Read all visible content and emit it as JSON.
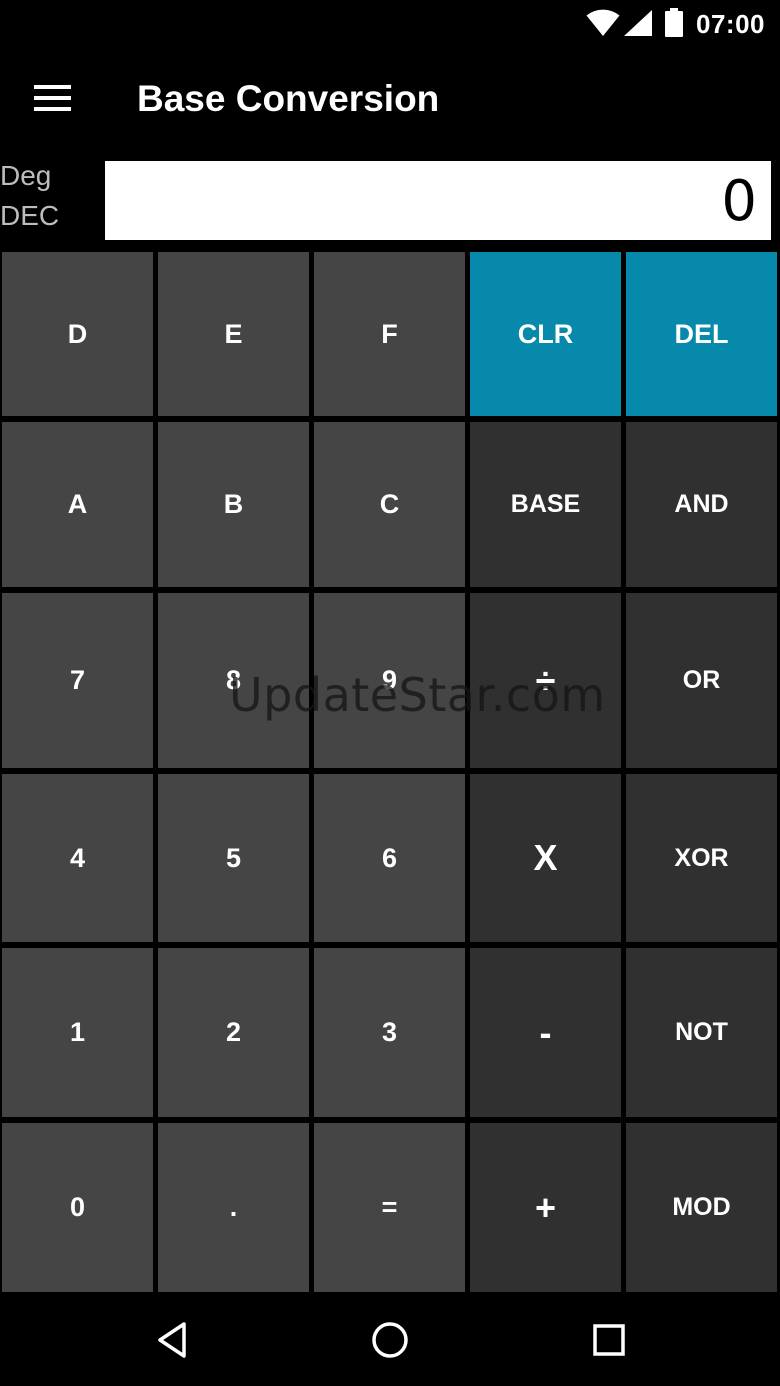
{
  "status_bar": {
    "time": "07:00",
    "icons": [
      "wifi-icon",
      "cell-signal-icon",
      "battery-icon"
    ]
  },
  "app_bar": {
    "title": "Base Conversion",
    "menu_icon": "hamburger-menu-icon"
  },
  "mode": {
    "angle": "Deg",
    "base": "DEC"
  },
  "display": {
    "value": "0"
  },
  "keys": {
    "D": "D",
    "E": "E",
    "F": "F",
    "CLR": "CLR",
    "DEL": "DEL",
    "A": "A",
    "B": "B",
    "C": "C",
    "BASE": "BASE",
    "AND": "AND",
    "n7": "7",
    "n8": "8",
    "n9": "9",
    "div": "÷",
    "OR": "OR",
    "n4": "4",
    "n5": "5",
    "n6": "6",
    "mul": "X",
    "XOR": "XOR",
    "n1": "1",
    "n2": "2",
    "n3": "3",
    "sub": "-",
    "NOT": "NOT",
    "n0": "0",
    "dot": ".",
    "eq": "=",
    "add": "+",
    "MOD": "MOD"
  },
  "watermark": "UpdateStar.com",
  "colors": {
    "accent": "#0689aa",
    "key_light": "#454545",
    "key_dark": "#303030",
    "background": "#000000",
    "display_bg": "#ffffff"
  },
  "nav_bar": {
    "icons": [
      "back-icon",
      "home-icon",
      "recents-icon"
    ]
  }
}
